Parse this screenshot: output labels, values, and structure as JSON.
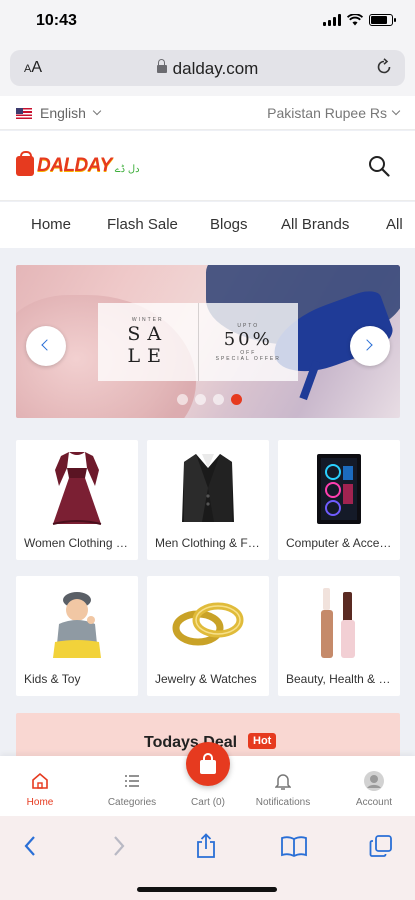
{
  "status_bar": {
    "time": "10:43",
    "battery_level": 0.8
  },
  "browser": {
    "text_size_label": "AA",
    "url": "dalday.com"
  },
  "locale": {
    "language": "English",
    "currency": "Pakistan Rupee Rs"
  },
  "header": {
    "logo_text": "DALDAY",
    "logo_subtext": "دل ڈے"
  },
  "nav": {
    "items": [
      {
        "label": "Home"
      },
      {
        "label": "Flash Sale"
      },
      {
        "label": "Blogs"
      },
      {
        "label": "All Brands"
      },
      {
        "label": "All"
      }
    ]
  },
  "banner": {
    "left_top": "WINTER",
    "left_main_1": "SA",
    "left_main_2": "LE",
    "right_top": "UPTO",
    "right_main": "50%",
    "right_off": "OFF",
    "right_bottom": "SPECIAL OFFER",
    "slide_count": 4,
    "active_slide": 4
  },
  "categories": [
    {
      "label": "Women Clothing & Fashion",
      "icon": "dress-icon"
    },
    {
      "label": "Men Clothing & Fashion",
      "icon": "suit-icon"
    },
    {
      "label": "Computer & Accessories",
      "icon": "computer-case-icon"
    },
    {
      "label": "Kids & Toy",
      "icon": "kid-icon"
    },
    {
      "label": "Jewelry & Watches",
      "icon": "rings-icon"
    },
    {
      "label": "Beauty, Health & Hair",
      "icon": "cosmetics-icon"
    }
  ],
  "deal": {
    "title": "Todays Deal",
    "badge": "Hot"
  },
  "bottom_nav": {
    "home": "Home",
    "categories": "Categories",
    "cart": "Cart (0)",
    "notifications": "Notifications",
    "account": "Account"
  },
  "colors": {
    "brand": "#e63a1f",
    "accent_blue": "#2a6fd6",
    "deal_bg": "#f9d7d2"
  }
}
